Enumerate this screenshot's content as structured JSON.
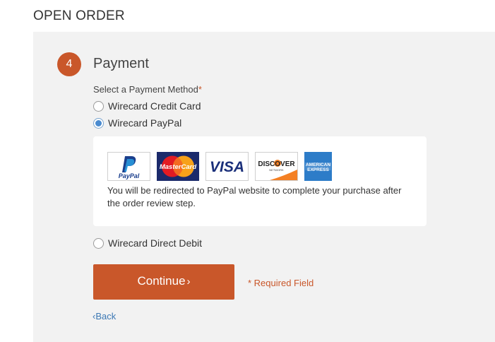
{
  "header": {
    "title": "OPEN ORDER"
  },
  "step": {
    "number": "4",
    "title": "Payment"
  },
  "payment": {
    "select_label": "Select a Payment Method",
    "required_star": "*",
    "methods": [
      {
        "label": "Wirecard Credit Card",
        "selected": false
      },
      {
        "label": "Wirecard PayPal",
        "selected": true
      },
      {
        "label": "Wirecard Direct Debit",
        "selected": false
      }
    ],
    "paypal_logo": {
      "top": "Pay",
      "bottom": "PayPal"
    },
    "mastercard_logo": "MasterCard",
    "visa_logo": "VISA",
    "discover_logo": {
      "name": "DISCOVER",
      "sub": "NETWORK"
    },
    "amex_logo": {
      "line1": "AMERICAN",
      "line2": "EXPRESS"
    },
    "redirect_message": "You will be redirected to PayPal website to complete your purchase after the order review step."
  },
  "actions": {
    "continue_label": "Continue",
    "continue_chevron": "›",
    "required_field_note": "* Required Field",
    "back_chevron": "‹",
    "back_label": "Back"
  },
  "colors": {
    "accent": "#c9572a",
    "link": "#3c78b4",
    "panel_bg": "#f2f2f2",
    "radio_selected": "#4a8bd0"
  }
}
